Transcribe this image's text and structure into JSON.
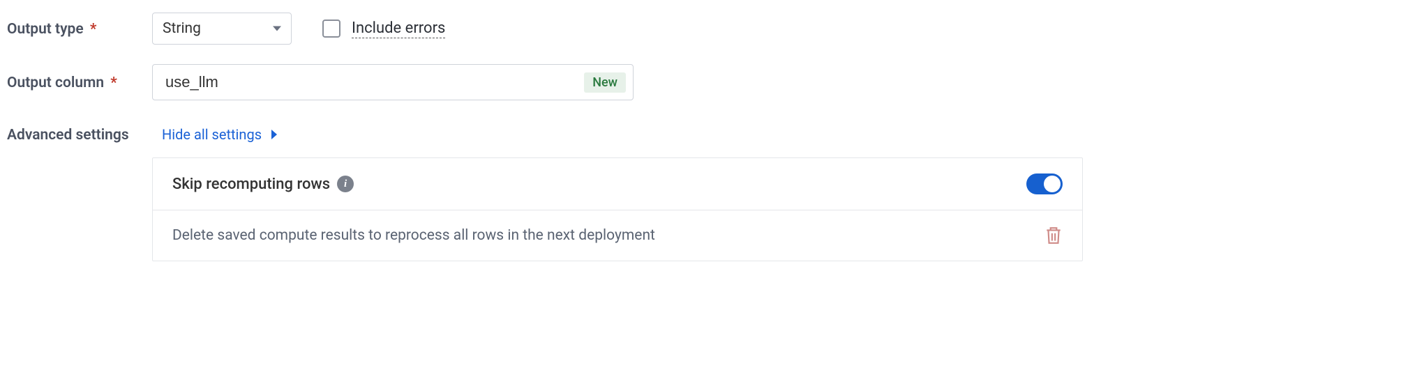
{
  "outputType": {
    "label": "Output type",
    "required_mark": "*",
    "selected": "String"
  },
  "includeErrors": {
    "label": "Include errors",
    "checked": false
  },
  "outputColumn": {
    "label": "Output column",
    "required_mark": "*",
    "value": "use_llm",
    "badge": "New"
  },
  "advanced": {
    "label": "Advanced settings",
    "toggleLink": "Hide all settings",
    "skipRecompute": {
      "label": "Skip recomputing rows",
      "enabled": true
    },
    "deleteSaved": {
      "description": "Delete saved compute results to reprocess all rows in the next deployment"
    }
  }
}
